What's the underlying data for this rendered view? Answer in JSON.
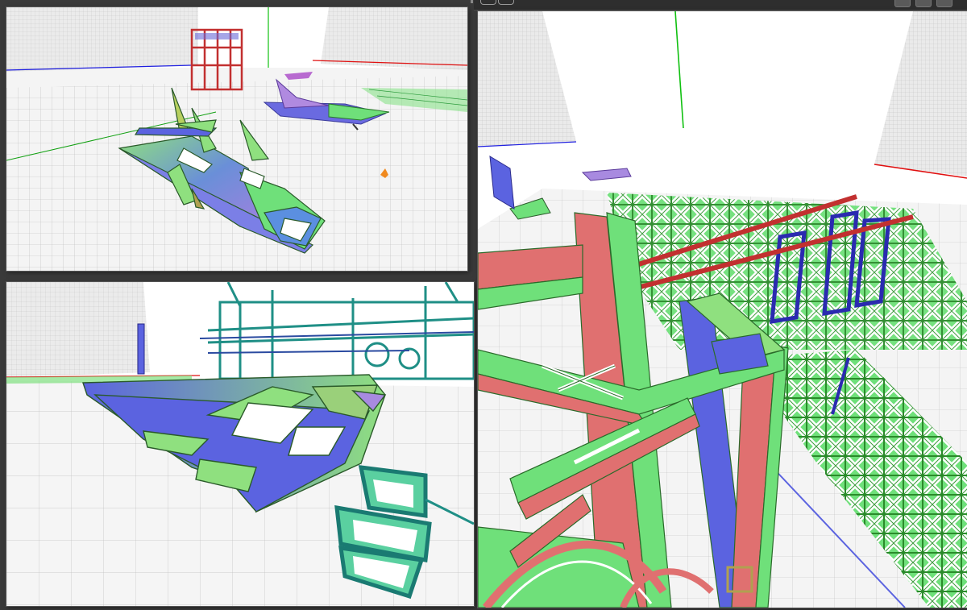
{
  "app": {
    "window_controls": [
      "minimize-button",
      "maximize-button",
      "close-button"
    ]
  },
  "viewports": [
    {
      "id": "top-left",
      "scene": "aircraft-close-up"
    },
    {
      "id": "bottom-left",
      "scene": "aircraft-structure-view"
    },
    {
      "id": "right",
      "scene": "truss-structure-overview"
    }
  ],
  "colors": {
    "grid_line": "#bdbdbd",
    "floor": "#f3f3f3",
    "wall": "#d9d9d9",
    "axis_x": "#e01010",
    "axis_y": "#10c010",
    "axis_z": "#1010e0",
    "mesh_green": "#6fe07a",
    "mesh_blue": "#5b63e0",
    "mesh_red": "#e07070",
    "mesh_teal": "#1f8f86",
    "frame_bg": "#3a3a3a"
  }
}
